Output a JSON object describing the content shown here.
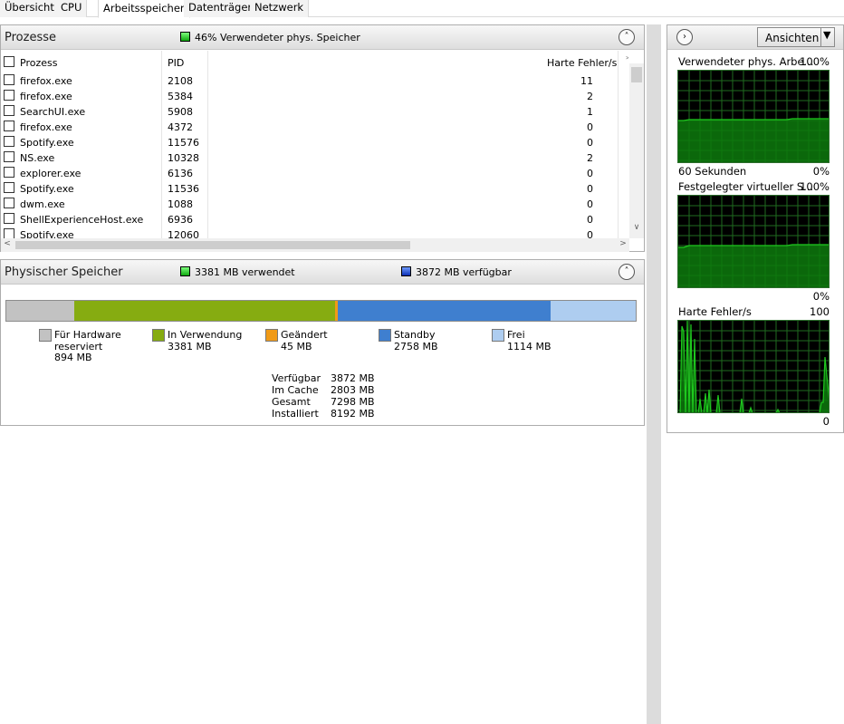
{
  "tabs": [
    {
      "label": "Übersicht"
    },
    {
      "label": "CPU"
    },
    {
      "label": "Arbeitsspeicher"
    },
    {
      "label": "Datenträger"
    },
    {
      "label": "Netzwerk"
    }
  ],
  "processes_panel": {
    "title": "Prozesse",
    "info": "46% Verwendeter phys. Speicher",
    "columns": {
      "name": "Prozess",
      "pid": "PID",
      "faults": "Harte Fehler/s"
    },
    "rows": [
      {
        "name": "firefox.exe",
        "pid": "2108",
        "faults": "11"
      },
      {
        "name": "firefox.exe",
        "pid": "5384",
        "faults": "2"
      },
      {
        "name": "SearchUI.exe",
        "pid": "5908",
        "faults": "1"
      },
      {
        "name": "firefox.exe",
        "pid": "4372",
        "faults": "0"
      },
      {
        "name": "Spotify.exe",
        "pid": "11576",
        "faults": "0"
      },
      {
        "name": "NS.exe",
        "pid": "10328",
        "faults": "2"
      },
      {
        "name": "explorer.exe",
        "pid": "6136",
        "faults": "0"
      },
      {
        "name": "Spotify.exe",
        "pid": "11536",
        "faults": "0"
      },
      {
        "name": "dwm.exe",
        "pid": "1088",
        "faults": "0"
      },
      {
        "name": "ShellExperienceHost.exe",
        "pid": "6936",
        "faults": "0"
      },
      {
        "name": "Spotify.exe",
        "pid": "12060",
        "faults": "0"
      }
    ]
  },
  "physical_panel": {
    "title": "Physischer Speicher",
    "used": "3381 MB verwendet",
    "available": "3872 MB verfügbar",
    "legend": [
      {
        "line1": "Für Hardware",
        "line2": "reserviert",
        "line3": "894 MB",
        "color": "#c2c2c2"
      },
      {
        "line1": "In Verwendung",
        "line2": "3381 MB",
        "color": "#86ac11"
      },
      {
        "line1": "Geändert",
        "line2": "45 MB",
        "color": "#f09a17"
      },
      {
        "line1": "Standby",
        "line2": "2758 MB",
        "color": "#3f7fcf"
      },
      {
        "line1": "Frei",
        "line2": "1114 MB",
        "color": "#aecdf0"
      }
    ],
    "stats": [
      {
        "label": "Verfügbar",
        "value": "3872 MB"
      },
      {
        "label": "Im Cache",
        "value": "2803 MB"
      },
      {
        "label": "Gesamt",
        "value": "7298 MB"
      },
      {
        "label": "Installiert",
        "value": "8192 MB"
      }
    ]
  },
  "right_pane": {
    "view_button": "Ansichten",
    "graphs": [
      {
        "title": "Verwendeter phys. Arbe...",
        "max": "100%",
        "min": "0%",
        "bottom_left": "60 Sekunden"
      },
      {
        "title": "Festgelegter virtueller S...",
        "max": "100%",
        "min": "0%"
      },
      {
        "title": "Harte Fehler/s",
        "max": "100",
        "min": "0"
      }
    ]
  },
  "colors": {
    "graph_line": "#1ec81e",
    "graph_fill": "#0d7a0d",
    "graph_grid": "#1f6b1f"
  }
}
